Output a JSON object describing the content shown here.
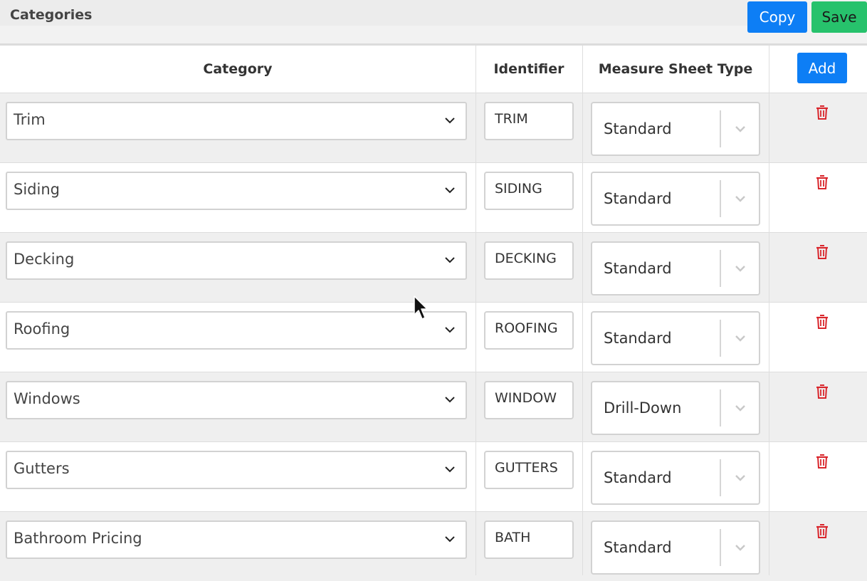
{
  "header": {
    "title": "Categories",
    "copy_label": "Copy",
    "save_label": "Save"
  },
  "table": {
    "columns": [
      "Category",
      "Identifier",
      "Measure Sheet Type"
    ],
    "add_label": "Add",
    "rows": [
      {
        "category": "Trim",
        "identifier": "TRIM",
        "measure_sheet_type": "Standard"
      },
      {
        "category": "Siding",
        "identifier": "SIDING",
        "measure_sheet_type": "Standard"
      },
      {
        "category": "Decking",
        "identifier": "DECKING",
        "measure_sheet_type": "Standard"
      },
      {
        "category": "Roofing",
        "identifier": "ROOFING",
        "measure_sheet_type": "Standard"
      },
      {
        "category": "Windows",
        "identifier": "WINDOW",
        "measure_sheet_type": "Drill-Down"
      },
      {
        "category": "Gutters",
        "identifier": "GUTTERS",
        "measure_sheet_type": "Standard"
      },
      {
        "category": "Bathroom Pricing",
        "identifier": "BATH",
        "measure_sheet_type": "Standard"
      }
    ]
  },
  "icons": {
    "delete": "trash-icon",
    "dropdown": "chevron-down-icon",
    "pointer": "mouse-cursor-icon"
  },
  "colors": {
    "primary": "#0d7ef5",
    "success": "#27c26c",
    "danger": "#d9262c",
    "row_alt": "#efefef"
  }
}
